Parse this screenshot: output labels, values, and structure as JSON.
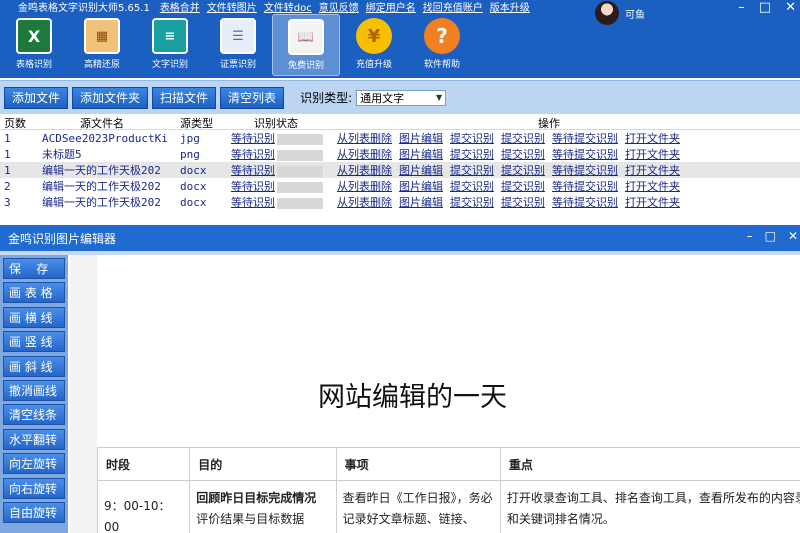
{
  "app": {
    "title": "金鸣表格文字识别大师5.65.1",
    "menu_links": [
      "表格合并",
      "文件转图片",
      "文件转doc",
      "意见反馈",
      "绑定用户名",
      "找回充值账户",
      "版本升级"
    ],
    "user_name": "可鱼",
    "window_controls": [
      "–",
      "□",
      "✕"
    ]
  },
  "toolbar": [
    {
      "label": "表格识别",
      "icon": "excel-icon",
      "glyph": "X"
    },
    {
      "label": "高精还原",
      "icon": "restore-icon",
      "glyph": "▦"
    },
    {
      "label": "文字识别",
      "icon": "text-doc-icon",
      "glyph": "≡"
    },
    {
      "label": "证票识别",
      "icon": "id-card-icon",
      "glyph": "☰"
    },
    {
      "label": "免费识别",
      "icon": "book-icon",
      "glyph": "📖"
    },
    {
      "label": "充值升级",
      "icon": "coin-icon",
      "glyph": "¥"
    },
    {
      "label": "软件帮助",
      "icon": "help-icon",
      "glyph": "?"
    }
  ],
  "actions": {
    "buttons": [
      "添加文件",
      "添加文件夹",
      "扫描文件",
      "清空列表"
    ],
    "type_label": "识别类型:",
    "type_value": "通用文字"
  },
  "filelist": {
    "headers": {
      "page": "页数",
      "name": "源文件名",
      "type": "源类型",
      "status": "识别状态",
      "ops": "操作"
    },
    "rows": [
      {
        "page": "1",
        "name": "ACDSee2023ProductKi",
        "type": "jpg",
        "status": "等待识别"
      },
      {
        "page": "1",
        "name": "未标题5",
        "type": "png",
        "status": "等待识别"
      },
      {
        "page": "1",
        "name": "编辑一天的工作天极202",
        "type": "docx",
        "status": "等待识别"
      },
      {
        "page": "2",
        "name": "编辑一天的工作天极202",
        "type": "docx",
        "status": "等待识别"
      },
      {
        "page": "3",
        "name": "编辑一天的工作天极202",
        "type": "docx",
        "status": "等待识别"
      }
    ],
    "op_labels": [
      "从列表删除",
      "图片编辑",
      "提交识别",
      "提交识别",
      "等待提交识别",
      "打开文件夹"
    ]
  },
  "editor": {
    "title": "金鸣识别图片编辑器",
    "window_controls": [
      "–",
      "□",
      "✕"
    ],
    "side_buttons": [
      "保    存",
      "画 表 格",
      "画 横 线",
      "画 竖 线",
      "画 斜 线",
      "撤消画线",
      "清空线条",
      "水平翻转",
      "向左旋转",
      "向右旋转",
      "自由旋转"
    ],
    "doc": {
      "title": "网站编辑的一天",
      "table_headers": [
        "时段",
        "目的",
        "事项",
        "重点"
      ],
      "row1": {
        "time": "9：00-10：00",
        "purpose_bold": "回顾昨日目标完成情况",
        "purpose_rest": "评价结果与目标数据",
        "item": "查看昨日《工作日报》，务必记录好文章标题、链接、",
        "focus": "打开收录查询工具、排名查询工具，查看所发布的内容录和关键词排名情况。"
      }
    }
  }
}
